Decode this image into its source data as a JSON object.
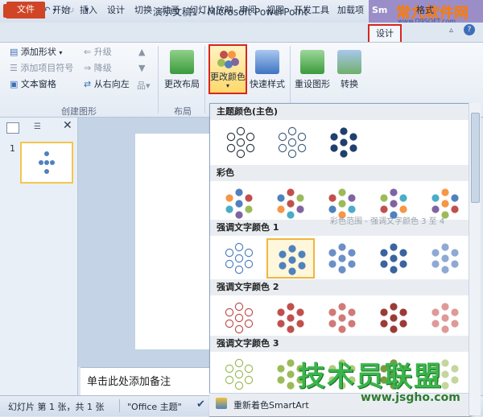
{
  "app": {
    "title": "演示文稿1 - Microsoft PowerPoint",
    "ppt_logo": "P",
    "smartart_context": "Sm",
    "watermark_top": "常九软件网",
    "watermark_top_url": "www.D9SOFT.com",
    "watermark_bottom": "技术员联盟",
    "watermark_bottom_url": "www.jsgho.com"
  },
  "tabs": {
    "file": "文件",
    "items": [
      "开始",
      "插入",
      "设计",
      "切换",
      "动画",
      "幻灯片放映",
      "审阅",
      "视图",
      "开发工具",
      "加载项"
    ],
    "design": "设计",
    "format": "格式"
  },
  "ribbon": {
    "create_graphic": {
      "add_shape": "添加形状",
      "add_bullet": "添加项目符号",
      "text_pane": "文本窗格",
      "promote": "升级",
      "demote": "降级",
      "right_to_left": "从右向左",
      "label": "创建图形"
    },
    "layouts": {
      "change_layout": "更改布局",
      "label": "布局"
    },
    "change_colors": "更改颜色",
    "quick_styles": "快速样式",
    "reset_graphic": "重设图形",
    "convert": "转换"
  },
  "slides_panel": {
    "slide_number": "1"
  },
  "notes": {
    "placeholder": "单击此处添加备注"
  },
  "status": {
    "slide_info": "幻灯片 第 1 张，共 1 张",
    "theme": "\"Office 主题\""
  },
  "gallery": {
    "sections": [
      {
        "title": "主题颜色(主色)",
        "swatches": [
          {
            "style": "outline",
            "fill": "#ffffff",
            "stroke": "#2f3a46"
          },
          {
            "style": "outline",
            "fill": "#ffffff",
            "stroke": "#46637d"
          },
          {
            "style": "solid",
            "fill": "#1f3f6e",
            "stroke": "#1f3f6e"
          }
        ]
      },
      {
        "title": "彩色",
        "swatches": [
          {
            "style": "multi",
            "colors": [
              "#4f81bd",
              "#c0504d",
              "#9bbb59",
              "#8064a2",
              "#4bacc6",
              "#f79646"
            ]
          },
          {
            "style": "multi",
            "colors": [
              "#c0504d",
              "#9bbb59",
              "#8064a2",
              "#4bacc6",
              "#f79646",
              "#4f81bd"
            ]
          },
          {
            "style": "multi",
            "colors": [
              "#9bbb59",
              "#8064a2",
              "#4bacc6",
              "#f79646",
              "#4f81bd",
              "#c0504d"
            ]
          },
          {
            "style": "multi",
            "colors": [
              "#8064a2",
              "#4bacc6",
              "#f79646",
              "#4f81bd",
              "#c0504d",
              "#9bbb59"
            ]
          },
          {
            "style": "multi",
            "colors": [
              "#f79646",
              "#4f81bd",
              "#c0504d",
              "#9bbb59",
              "#8064a2",
              "#4bacc6"
            ]
          }
        ]
      },
      {
        "title": "强调文字颜色 1",
        "swatches": [
          {
            "style": "outline",
            "fill": "#ffffff",
            "stroke": "#4f81bd"
          },
          {
            "style": "solid",
            "fill": "#4f81bd",
            "stroke": "#4f81bd",
            "selected": true
          },
          {
            "style": "solid",
            "fill": "#6d8fc7",
            "stroke": "#6d8fc7"
          },
          {
            "style": "solid",
            "fill": "#3a63a0",
            "stroke": "#3a63a0"
          },
          {
            "style": "solid",
            "fill": "#8fa9d3",
            "stroke": "#8fa9d3"
          }
        ]
      },
      {
        "title": "强调文字颜色 2",
        "swatches": [
          {
            "style": "outline",
            "fill": "#ffffff",
            "stroke": "#c0504d"
          },
          {
            "style": "solid",
            "fill": "#c0504d",
            "stroke": "#c0504d"
          },
          {
            "style": "solid",
            "fill": "#d07a78",
            "stroke": "#d07a78"
          },
          {
            "style": "solid",
            "fill": "#9a3b38",
            "stroke": "#9a3b38"
          },
          {
            "style": "solid",
            "fill": "#dd9a98",
            "stroke": "#dd9a98"
          }
        ]
      },
      {
        "title": "强调文字颜色 3",
        "swatches": [
          {
            "style": "outline",
            "fill": "#ffffff",
            "stroke": "#9bbb59"
          },
          {
            "style": "solid",
            "fill": "#9bbb59",
            "stroke": "#9bbb59"
          },
          {
            "style": "solid",
            "fill": "#b2cb80",
            "stroke": "#b2cb80"
          },
          {
            "style": "solid",
            "fill": "#7a9a3e",
            "stroke": "#7a9a3e"
          },
          {
            "style": "solid",
            "fill": "#c4d69d",
            "stroke": "#c4d69d"
          }
        ]
      }
    ],
    "tooltip": "彩色范围 - 强调文字颜色 3 至 4",
    "recolor": "重新着色SmartArt"
  }
}
